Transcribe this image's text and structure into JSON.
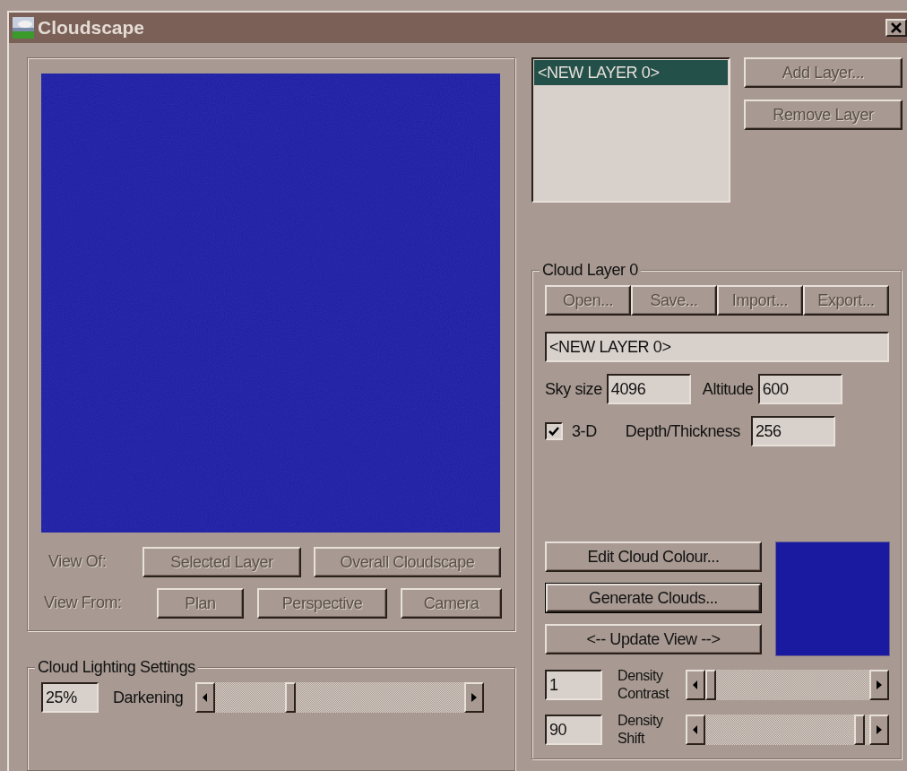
{
  "window": {
    "title": "Cloudscape"
  },
  "view_of": {
    "label": "View Of:",
    "disabled": true,
    "buttons": [
      {
        "label": "Selected Layer",
        "disabled": true
      },
      {
        "label": "Overall Cloudscape",
        "disabled": true
      }
    ]
  },
  "view_from": {
    "label": "View From:",
    "disabled": true,
    "buttons": [
      {
        "label": "Plan",
        "disabled": true
      },
      {
        "label": "Perspective",
        "disabled": true
      },
      {
        "label": "Camera",
        "disabled": true
      }
    ]
  },
  "lighting": {
    "title": "Cloud Lighting Settings",
    "value": "25%",
    "label": "Darkening",
    "level": 0.29
  },
  "layers": {
    "items": [
      {
        "label": "<NEW LAYER 0>",
        "selected": true
      }
    ],
    "buttons": [
      {
        "label": "Add Layer...",
        "disabled": true
      },
      {
        "label": "Remove Layer",
        "disabled": true
      }
    ]
  },
  "cloud_layer": {
    "title": "Cloud Layer 0",
    "file_buttons": [
      {
        "label": "Open...",
        "disabled": true
      },
      {
        "label": "Save...",
        "disabled": true
      },
      {
        "label": "Import...",
        "disabled": true
      },
      {
        "label": "Export...",
        "disabled": true
      }
    ],
    "name": "<NEW LAYER 0>",
    "sky_size": {
      "label": "Sky size",
      "value": "4096"
    },
    "altitude": {
      "label": "Altitude",
      "value": "600"
    },
    "three_d": {
      "label": "3-D",
      "checked": true
    },
    "depth": {
      "label": "Depth/Thickness",
      "value": "256"
    },
    "actions": [
      {
        "label": "Edit Cloud Colour...",
        "default": false
      },
      {
        "label": "Generate Clouds...",
        "default": true
      },
      {
        "label": "<-- Update View -->",
        "default": false
      }
    ],
    "color": "#1a1aa0",
    "density": [
      {
        "value": "1",
        "label": "Density\nContrast",
        "level": 0.0
      },
      {
        "value": "90",
        "label": "Density\nShift",
        "level": 0.97
      }
    ]
  }
}
